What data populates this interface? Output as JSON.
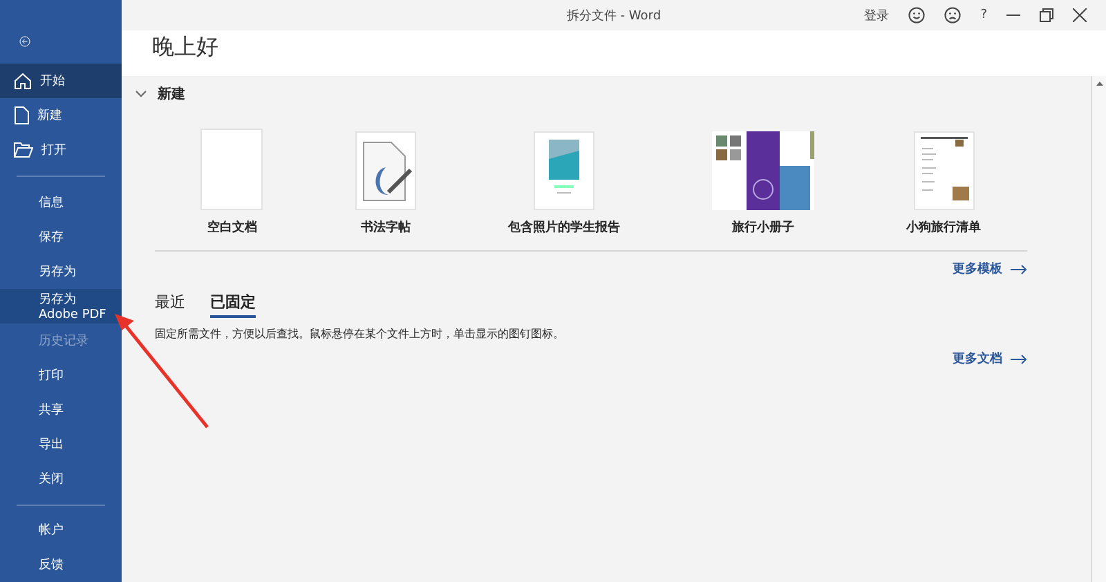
{
  "window": {
    "title": "拆分文件 - Word",
    "sign_in": "登录",
    "help": "?"
  },
  "sidebar": {
    "groups": [
      [
        {
          "label": "开始",
          "selected": true,
          "hovered": false,
          "disabled": false
        },
        {
          "label": "新建",
          "selected": false,
          "hovered": false,
          "disabled": false
        },
        {
          "label": "打开",
          "selected": false,
          "hovered": false,
          "disabled": false
        }
      ],
      [
        {
          "label": "信息",
          "selected": false,
          "hovered": false,
          "disabled": false
        },
        {
          "label": "保存",
          "selected": false,
          "hovered": false,
          "disabled": false
        },
        {
          "label": "另存为",
          "selected": false,
          "hovered": false,
          "disabled": false
        },
        {
          "label": "另存为 Adobe PDF",
          "selected": false,
          "hovered": true,
          "disabled": false
        },
        {
          "label": "历史记录",
          "selected": false,
          "hovered": false,
          "disabled": true
        },
        {
          "label": "打印",
          "selected": false,
          "hovered": false,
          "disabled": false
        },
        {
          "label": "共享",
          "selected": false,
          "hovered": false,
          "disabled": false
        },
        {
          "label": "导出",
          "selected": false,
          "hovered": false,
          "disabled": false
        },
        {
          "label": "关闭",
          "selected": false,
          "hovered": false,
          "disabled": false
        }
      ],
      [
        {
          "label": "帐户",
          "selected": false,
          "hovered": false,
          "disabled": false
        },
        {
          "label": "反馈",
          "selected": false,
          "hovered": false,
          "disabled": false
        }
      ]
    ]
  },
  "greeting": "晚上好",
  "new_section": {
    "title": "新建",
    "expanded": true,
    "templates": [
      {
        "label": "空白文档",
        "kind": "blank"
      },
      {
        "label": "书法字帖",
        "kind": "calligraphy"
      },
      {
        "label": "包含照片的学生报告",
        "kind": "report"
      },
      {
        "label": "旅行小册子",
        "kind": "brochure"
      },
      {
        "label": "小狗旅行清单",
        "kind": "checklist"
      }
    ],
    "more": "更多模板"
  },
  "file_tabs": [
    {
      "label": "最近",
      "selected": false
    },
    {
      "label": "已固定",
      "selected": true
    }
  ],
  "pinned_hint": "固定所需文件，方便以后查找。鼠标悬停在某个文件上方时，单击显示的图钉图标。",
  "more_docs": "更多文档"
}
